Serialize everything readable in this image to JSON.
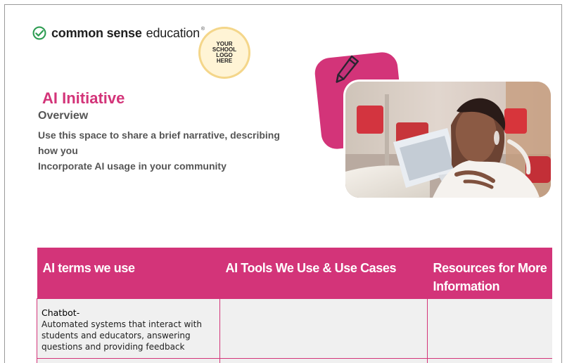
{
  "brand": {
    "name_bold": "common sense",
    "name_light": "education",
    "registered": "®",
    "accent_color": "#2e9d53"
  },
  "logo_placeholder": {
    "lines": [
      "YOUR",
      "SCHOOL",
      "LOGO",
      "HERE"
    ]
  },
  "page": {
    "title": "AI Initiative",
    "subtitle": "Overview",
    "narrative_lines": [
      "Use this space to share  a brief narrative, describing",
      "how you",
      "Incorporate AI usage in your community"
    ],
    "accent_color": "#d33479"
  },
  "icons": {
    "brand_mark": "check-circle-icon",
    "pencil": "pencil-icon"
  },
  "table": {
    "headers": [
      "AI terms we use",
      "AI Tools We Use & Use Cases",
      "Resources for More Information"
    ],
    "rows": [
      {
        "term": "Chatbot-",
        "description": "Automated systems that interact with students and educators, answering questions and providing feedback",
        "tools": "",
        "resources": ""
      }
    ]
  }
}
